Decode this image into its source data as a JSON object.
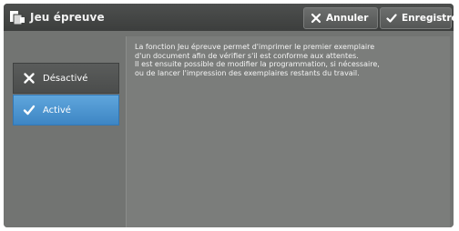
{
  "header": {
    "title": "Jeu épreuve",
    "title_icon": "proof-print-icon",
    "cancel_label": "Annuler",
    "cancel_icon": "close-icon",
    "save_label": "Enregistrer",
    "save_icon": "checkmark-icon"
  },
  "options": [
    {
      "label": "Désactivé",
      "icon": "close-icon",
      "selected": false
    },
    {
      "label": "Activé",
      "icon": "checkmark-icon",
      "selected": true
    }
  ],
  "info": {
    "text": "La fonction Jeu épreuve permet d'imprimer le premier exemplaire\nd'un document afin de vérifier s'il est conforme aux attentes.\nIl est ensuite possible de modifier la programmation, si nécessaire,\nou de lancer l'impression des exemplaires restants du travail."
  },
  "colors": {
    "header_bg": "#3c3e3d",
    "panel_bg": "#727472",
    "selected_accent": "#3d86c4"
  }
}
